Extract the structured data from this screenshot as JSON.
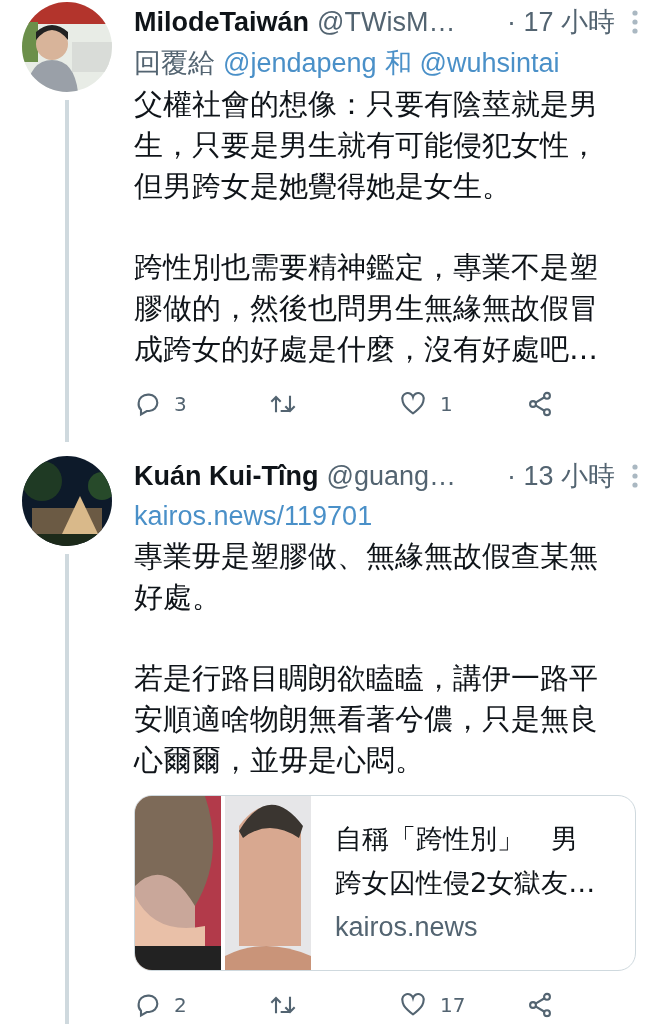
{
  "tweets": [
    {
      "name": "MilodeTaiwán",
      "handle": "@TWisM…",
      "time": "· 17 小時",
      "reply_to": {
        "prefix": "回覆給",
        "users": [
          "@jendapeng",
          "@wuhsintai"
        ],
        "joiner": "和"
      },
      "paragraphs": [
        "父權社會的想像：只要有陰莖就是男生，只要是男生就有可能侵犯女性，但男跨女是她覺得她是女生。",
        "跨性別也需要精神鑑定，專業不是塑膠做的，然後也問男生無緣無故假冒成跨女的好處是什麼，沒有好處吧…"
      ],
      "actions": {
        "replies": "3",
        "likes": "1"
      }
    },
    {
      "name": "Kuán Kui-Tîng",
      "handle": "@guang…",
      "time": "· 13 小時",
      "link": "kairos.news/119701",
      "paragraphs": [
        "專業毋是塑膠做、無緣無故假查某無好處。",
        "若是行路目睭朗欲瞌瞌，講伊一路平安順適啥物朗無看著兮儂，只是無良心爾爾，並毋是心悶。"
      ],
      "card": {
        "title_lines": [
          "自稱「跨性別」　男",
          "跨女囚性侵2女獄友…"
        ],
        "domain": "kairos.news"
      },
      "actions": {
        "replies": "2",
        "likes": "17"
      }
    }
  ]
}
